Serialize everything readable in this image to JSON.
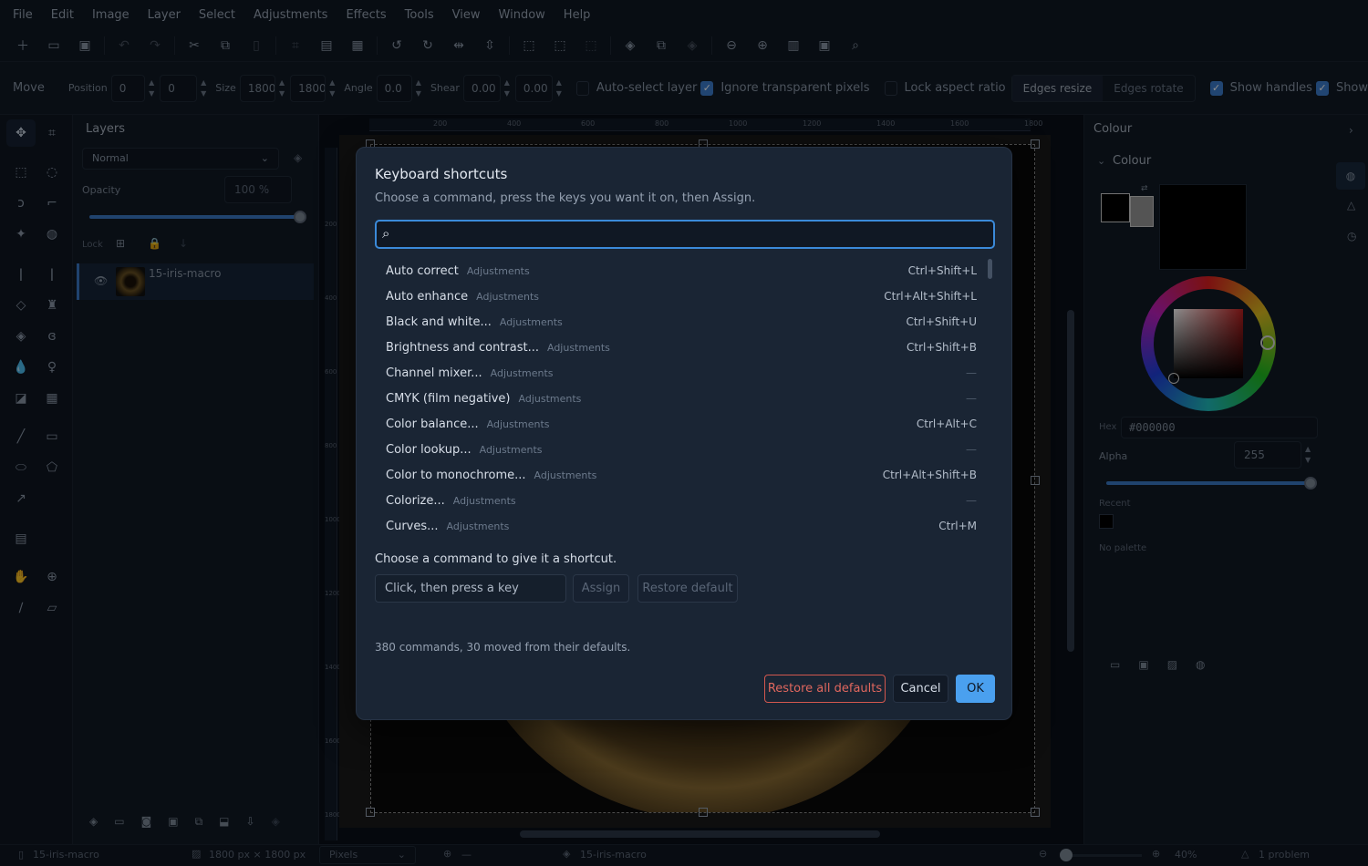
{
  "menu": [
    "File",
    "Edit",
    "Image",
    "Layer",
    "Select",
    "Adjustments",
    "Effects",
    "Tools",
    "View",
    "Window",
    "Help"
  ],
  "toolbar_icons": [
    "new-icon",
    "open-icon",
    "save-icon",
    "undo-icon",
    "redo-icon",
    "cut-icon",
    "copy-icon",
    "paste-icon",
    "crop-icon",
    "resize-icon",
    "canvas-icon",
    "rotate-left-icon",
    "rotate-right-icon",
    "flip-h-icon",
    "flip-v-icon",
    "select-all-icon",
    "deselect-icon",
    "invert-icon",
    "layers-icon",
    "duplicate-icon",
    "merge-icon",
    "zoom-out-icon",
    "zoom-in-icon",
    "fit-icon",
    "actual-icon",
    "search-icon"
  ],
  "options": {
    "tool_name": "Move",
    "position_label": "Position",
    "pos_x": "0",
    "pos_y": "0",
    "size_label": "Size",
    "size_w": "1800",
    "size_h": "1800",
    "angle_label": "Angle",
    "angle": "0.0",
    "shear_label": "Shear",
    "shear_x": "0.00",
    "shear_y": "0.00",
    "auto_select": "Auto-select layer",
    "ignore_transparent": "Ignore transparent pixels",
    "lock_aspect": "Lock aspect ratio",
    "edges_resize": "Edges resize",
    "edges_rotate": "Edges rotate",
    "show_handles": "Show handles",
    "show_overflow": "Show"
  },
  "layers_panel": {
    "title": "Layers",
    "blend_mode": "Normal",
    "opacity_label": "Opacity",
    "opacity_value": "100 %",
    "lock_label": "Lock",
    "layer_name": "15-iris-macro"
  },
  "ruler_ticks": [
    "200",
    "400",
    "600",
    "800",
    "1000",
    "1200",
    "1400",
    "1600",
    "1800"
  ],
  "vruler_ticks": [
    "200",
    "400",
    "600",
    "800",
    "1000",
    "1200",
    "1400",
    "1600",
    "1800"
  ],
  "colour_panel": {
    "title": "Colour",
    "section": "Colour",
    "hex_label": "Hex",
    "hex_value": "#000000",
    "alpha_label": "Alpha",
    "alpha_value": "255",
    "recent_label": "Recent",
    "no_palette": "No palette"
  },
  "dialog": {
    "title": "Keyboard shortcuts",
    "subtitle": "Choose a command, press the keys you want it on, then Assign.",
    "search_placeholder": "",
    "commands": [
      {
        "name": "Auto correct",
        "category": "Adjustments",
        "shortcut": "Ctrl+Shift+L"
      },
      {
        "name": "Auto enhance",
        "category": "Adjustments",
        "shortcut": "Ctrl+Alt+Shift+L"
      },
      {
        "name": "Black and white...",
        "category": "Adjustments",
        "shortcut": "Ctrl+Shift+U"
      },
      {
        "name": "Brightness and contrast...",
        "category": "Adjustments",
        "shortcut": "Ctrl+Shift+B"
      },
      {
        "name": "Channel mixer...",
        "category": "Adjustments",
        "shortcut": "—"
      },
      {
        "name": "CMYK (film negative)",
        "category": "Adjustments",
        "shortcut": "—"
      },
      {
        "name": "Color balance...",
        "category": "Adjustments",
        "shortcut": "Ctrl+Alt+C"
      },
      {
        "name": "Color lookup...",
        "category": "Adjustments",
        "shortcut": "—"
      },
      {
        "name": "Color to monochrome...",
        "category": "Adjustments",
        "shortcut": "Ctrl+Alt+Shift+B"
      },
      {
        "name": "Colorize...",
        "category": "Adjustments",
        "shortcut": "—"
      },
      {
        "name": "Curves...",
        "category": "Adjustments",
        "shortcut": "Ctrl+M"
      }
    ],
    "choose_label": "Choose a command to give it a shortcut.",
    "key_field_placeholder": "Click, then press a key",
    "assign_label": "Assign",
    "restore_default_label": "Restore default",
    "count_text": "380 commands, 30 moved from their defaults.",
    "restore_all_label": "Restore all defaults",
    "cancel_label": "Cancel",
    "ok_label": "OK"
  },
  "status": {
    "doc_name": "15-iris-macro",
    "dimensions": "1800 px × 1800 px",
    "units": "Pixels",
    "coords": "—",
    "layer_name": "15-iris-macro",
    "zoom": "40%",
    "problems": "1 problem"
  }
}
